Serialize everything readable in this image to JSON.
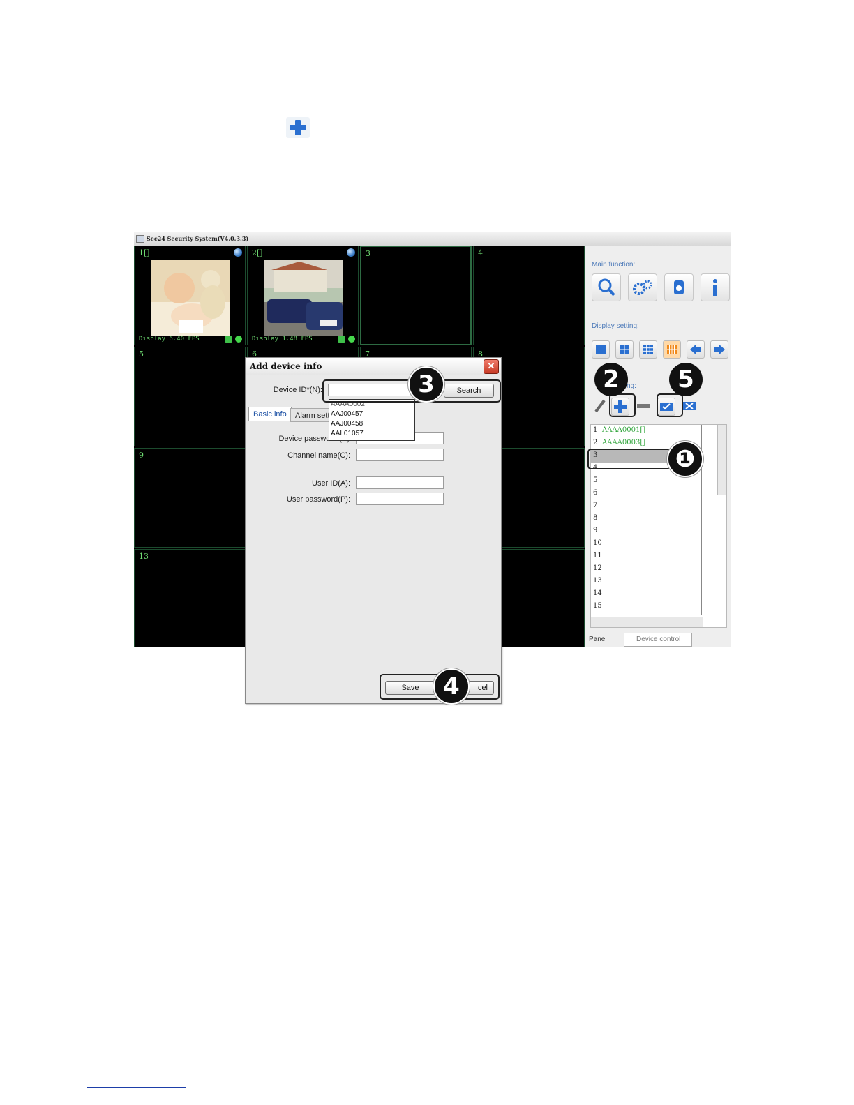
{
  "app": {
    "title": "Sec24 Security System(V4.0.3.3)"
  },
  "grid": {
    "cells": [
      {
        "num": "1[]",
        "status": "Display  6.40 FPS"
      },
      {
        "num": "2[]",
        "status": "Display  1.48 FPS"
      },
      {
        "num": "3"
      },
      {
        "num": "4"
      },
      {
        "num": "5"
      },
      {
        "num": "6"
      },
      {
        "num": "7"
      },
      {
        "num": "8"
      },
      {
        "num": "9"
      },
      {
        "num": "13"
      }
    ]
  },
  "side": {
    "main_function": "Main function:",
    "display_setting": "Display setting:",
    "device_setting": "ng:",
    "devices": [
      {
        "n": "1",
        "id": "AAAA0001[]"
      },
      {
        "n": "2",
        "id": "AAAA0003[]"
      },
      {
        "n": "3",
        "id": ""
      },
      {
        "n": "4",
        "id": ""
      },
      {
        "n": "5",
        "id": ""
      },
      {
        "n": "6",
        "id": ""
      },
      {
        "n": "7",
        "id": ""
      },
      {
        "n": "8",
        "id": ""
      },
      {
        "n": "9",
        "id": ""
      },
      {
        "n": "10",
        "id": ""
      },
      {
        "n": "11",
        "id": ""
      },
      {
        "n": "12",
        "id": ""
      },
      {
        "n": "13",
        "id": ""
      },
      {
        "n": "14",
        "id": ""
      },
      {
        "n": "15",
        "id": ""
      }
    ],
    "tab_panel": "Panel",
    "tab_device_control": "Device control"
  },
  "dialog": {
    "title": "Add device info",
    "close_glyph": "✕",
    "device_id_label": "Device ID*(N):",
    "search_label": "Search",
    "tab_basic": "Basic info",
    "tab_alarm": "Alarm sett",
    "device_password_label": "Device password (P):",
    "channel_name_label": "Channel name(C):",
    "user_id_label": "User ID(A):",
    "user_password_label": "User password(P):",
    "save_label": "Save",
    "cancel_label": "cel",
    "dropdown_options": [
      "AAAA0002",
      "AAJ00457",
      "AAJ00458",
      "AAL01057"
    ]
  },
  "markers": {
    "m1": "❶",
    "m2": "2",
    "m3": "3",
    "m4": "4",
    "m5": "5"
  },
  "colors": {
    "accent_blue": "#2a6fd0",
    "grid_green": "#6fdc72",
    "status_green": "#45d84c"
  }
}
